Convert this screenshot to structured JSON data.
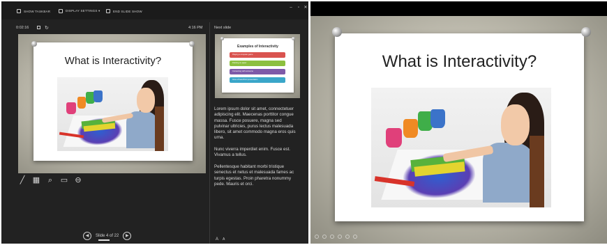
{
  "toolbar": {
    "show_taskbar": "SHOW TASKBAR",
    "display_settings": "DISPLAY SETTINGS ▾",
    "end_slide_show": "END SLIDE SHOW"
  },
  "timer": {
    "elapsed": "0:02:16",
    "clock": "4:16 PM"
  },
  "current_slide": {
    "title": "What is Interactivity?"
  },
  "next_slide": {
    "label": "Next slide",
    "title": "Examples of Interactivity",
    "items": [
      {
        "text": "Playing a computer game",
        "color": "#d9534f"
      },
      {
        "text": "Painting on paper",
        "color": "#8cbf3f"
      },
      {
        "text": "Conversing with someone",
        "color": "#7e5aa8"
      },
      {
        "text": "Give a PowerPoint presentation",
        "color": "#3aa6c9"
      }
    ]
  },
  "notes": [
    "Lorem ipsum dolor sit amet, connectetuer adipiscing elit. Maecenas porttitor congue massa. Fusce posuere, magna sed pulvinar ultricies, purus lectus malesuada libero, sit amet commodo magna eros quis urna.",
    "Nunc viverra imperdiet enim. Fusce est. Vivamus a tellus.",
    "Pellentesque habitant morbi tristique senectus et netus et malesuada fames ac turpis egestas. Proin pharetra nonummy pede. Mauris et orci."
  ],
  "navigation": {
    "slide_counter": "Slide 4 of 22"
  },
  "slideshow": {
    "title": "What is Interactivity?"
  }
}
